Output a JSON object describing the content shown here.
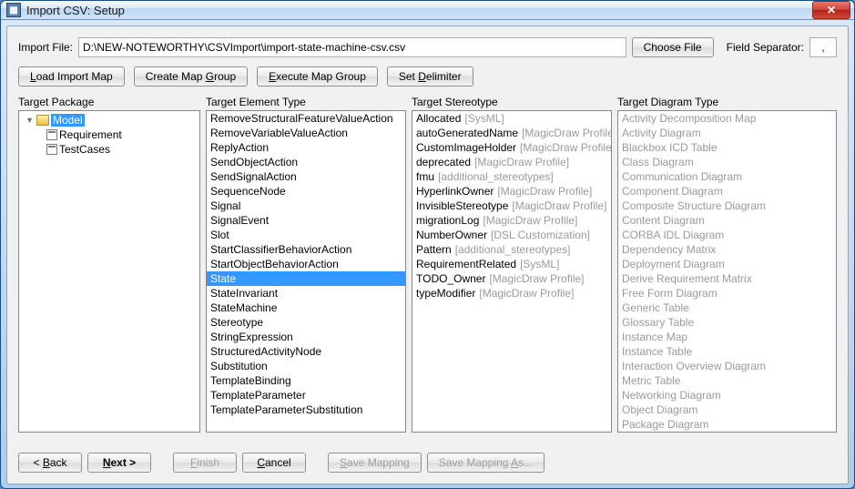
{
  "window": {
    "title": "Import CSV: Setup"
  },
  "fileRow": {
    "label": "Import File:",
    "path": "D:\\NEW-NOTEWORTHY\\CSVImport\\import-state-machine-csv.csv",
    "chooseBtn": "Choose File",
    "sepLabel": "Field Separator:",
    "sepValue": ","
  },
  "toolbar": {
    "loadMap": "Load Import Map",
    "createGroup": "Create Map Group",
    "execGroup": "Execute Map Group",
    "setDelim": "Set Delimiter"
  },
  "cols": {
    "pkgLabel": "Target Package",
    "elemLabel": "Target Element Type",
    "stereoLabel": "Target Stereotype",
    "diagLabel": "Target Diagram Type"
  },
  "tree": {
    "root": "Model",
    "children": [
      "Requirement",
      "TestCases"
    ]
  },
  "elementTypes": [
    "RemoveStructuralFeatureValueAction",
    "RemoveVariableValueAction",
    "ReplyAction",
    "SendObjectAction",
    "SendSignalAction",
    "SequenceNode",
    "Signal",
    "SignalEvent",
    "Slot",
    "StartClassifierBehaviorAction",
    "StartObjectBehaviorAction",
    "State",
    "StateInvariant",
    "StateMachine",
    "Stereotype",
    "StringExpression",
    "StructuredActivityNode",
    "Substitution",
    "TemplateBinding",
    "TemplateParameter",
    "TemplateParameterSubstitution"
  ],
  "selectedElementType": "State",
  "stereotypes": [
    {
      "n": "Allocated",
      "s": "[SysML]"
    },
    {
      "n": "autoGeneratedName",
      "s": "[MagicDraw Profile]"
    },
    {
      "n": "CustomImageHolder",
      "s": "[MagicDraw Profile]"
    },
    {
      "n": "deprecated",
      "s": "[MagicDraw Profile]"
    },
    {
      "n": "fmu",
      "s": "[additional_stereotypes]"
    },
    {
      "n": "HyperlinkOwner",
      "s": "[MagicDraw Profile]"
    },
    {
      "n": "InvisibleStereotype",
      "s": "[MagicDraw Profile]"
    },
    {
      "n": "migrationLog",
      "s": "[MagicDraw Profile]"
    },
    {
      "n": "NumberOwner",
      "s": "[DSL Customization]"
    },
    {
      "n": "Pattern",
      "s": "[additional_stereotypes]"
    },
    {
      "n": "RequirementRelated",
      "s": "[SysML]"
    },
    {
      "n": "TODO_Owner",
      "s": "[MagicDraw Profile]"
    },
    {
      "n": "typeModifier",
      "s": "[MagicDraw Profile]"
    }
  ],
  "diagramTypes": [
    "Activity Decomposition Map",
    "Activity Diagram",
    "Blackbox ICD Table",
    "Class Diagram",
    "Communication Diagram",
    "Component Diagram",
    "Composite Structure Diagram",
    "Content Diagram",
    "CORBA IDL Diagram",
    "Dependency Matrix",
    "Deployment Diagram",
    "Derive Requirement Matrix",
    "Free Form Diagram",
    "Generic Table",
    "Glossary Table",
    "Instance Map",
    "Instance Table",
    "Interaction Overview Diagram",
    "Metric Table",
    "Networking Diagram",
    "Object Diagram",
    "Package Diagram"
  ],
  "footer": {
    "back": "Back",
    "next": "Next >",
    "finish": "Finish",
    "cancel": "Cancel",
    "saveMap": "Save Mapping",
    "saveAs": "Save Mapping As..."
  }
}
